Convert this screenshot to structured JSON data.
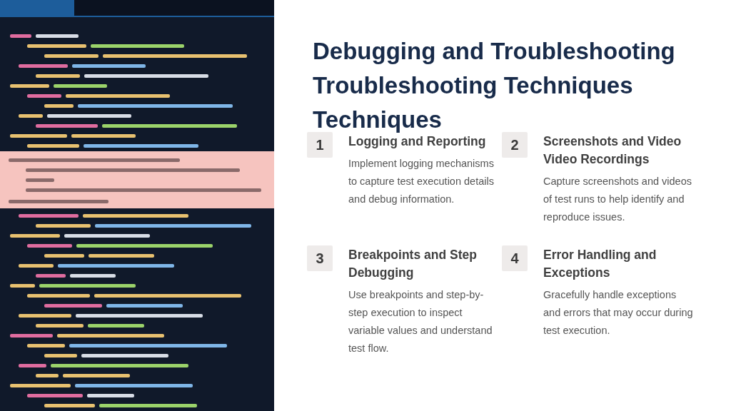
{
  "title": "Debugging and Troubleshooting Troubleshooting Techniques Techniques",
  "items": [
    {
      "number": "1",
      "heading": "Logging and Reporting",
      "body": "Implement logging mechanisms to capture test execution details and debug information."
    },
    {
      "number": "2",
      "heading": "Screenshots and Video Video Recordings",
      "body": "Capture screenshots and videos of test runs to help identify and reproduce issues."
    },
    {
      "number": "3",
      "heading": "Breakpoints and Step Debugging",
      "body": "Use breakpoints and step-by-step execution to inspect variable values and understand test flow."
    },
    {
      "number": "4",
      "heading": "Error Handling and Exceptions",
      "body": "Gracefully handle exceptions and errors that may occur during test execution."
    }
  ]
}
